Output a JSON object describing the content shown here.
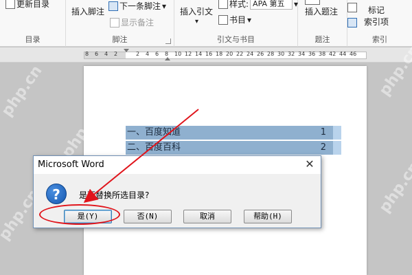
{
  "ribbon": {
    "groups": {
      "toc": {
        "label": "目录",
        "update_toc": "更新目录"
      },
      "footnotes": {
        "label": "脚注",
        "insert_footnote": "插入脚注",
        "next_footnote": "下一条脚注",
        "show_notes": "显示备注"
      },
      "citations": {
        "label": "引文与书目",
        "insert_citation": "插入引文",
        "style_label": "样式:",
        "style_value": "APA 第五",
        "bibliography": "书目"
      },
      "captions": {
        "label": "题注",
        "insert_caption": "插入题注"
      },
      "index": {
        "label": "索引",
        "mark_entry_line1": "标记",
        "mark_entry_line2": "索引项"
      }
    }
  },
  "ruler": {
    "left_numbers": [
      "8",
      "6",
      "4",
      "2"
    ],
    "right_numbers": [
      "2",
      "4",
      "6",
      "8",
      "10",
      "12",
      "14",
      "16",
      "18",
      "20",
      "22",
      "24",
      "26",
      "28",
      "30",
      "32",
      "34",
      "36",
      "38",
      "42",
      "44",
      "46"
    ]
  },
  "document": {
    "toc": [
      {
        "text": "一、百度知道",
        "page": "1"
      },
      {
        "text": "二、百度百科",
        "page": "2"
      }
    ]
  },
  "dialog": {
    "title": "Microsoft Word",
    "message": "是否替换所选目录?",
    "buttons": {
      "yes": "是(Y)",
      "no": "否(N)",
      "cancel": "取消",
      "help": "帮助(H)"
    }
  },
  "watermark": "php.cn",
  "colors": {
    "toc_highlight": "#8fb0cf",
    "annotation_red": "#e0141b",
    "dialog_border": "#6f8fb4"
  }
}
